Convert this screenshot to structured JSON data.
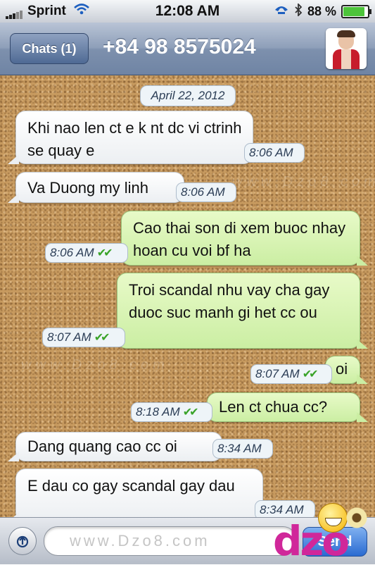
{
  "status_bar": {
    "carrier": "Sprint",
    "time": "12:08 AM",
    "battery_percent": "88 %",
    "battery_level": 0.88
  },
  "nav": {
    "back_label": "Chats (1)",
    "title": "+84 98 8575024"
  },
  "chat": {
    "date": "April 22, 2012",
    "messages": [
      {
        "dir": "in",
        "text": "Khi nao len ct e k nt dc vi ctrinh se quay e",
        "time": "8:06 AM"
      },
      {
        "dir": "in",
        "text": "Va Duong my linh",
        "time": "8:06 AM"
      },
      {
        "dir": "out",
        "text": "Cao thai son di xem buoc nhay hoan cu voi bf ha",
        "time": "8:06 AM",
        "ticks": "✔✔"
      },
      {
        "dir": "out",
        "text": "Troi scandal nhu vay cha gay duoc suc manh gi het cc ou",
        "time": "8:07 AM",
        "ticks": "✔✔"
      },
      {
        "dir": "out",
        "text": "oi",
        "time": "8:07 AM",
        "ticks": "✔✔"
      },
      {
        "dir": "out",
        "text": "Len ct chua cc?",
        "time": "8:18 AM",
        "ticks": "✔✔"
      },
      {
        "dir": "in",
        "text": "Dang quang cao cc oi",
        "time": "8:34 AM"
      },
      {
        "dir": "in",
        "text": "E dau co gay scandal  gay dau",
        "time": "8:34 AM"
      }
    ]
  },
  "input": {
    "placeholder": "www.Dzo8.com",
    "send_label": "Send"
  },
  "watermarks": {
    "text_a": "www.Dzo8.com",
    "logo_text": "dzo"
  },
  "icons": {
    "wifi": "wifi-icon",
    "phone": "phone-forward-icon",
    "bluetooth": "bluetooth-icon",
    "camera": "camera-icon"
  }
}
